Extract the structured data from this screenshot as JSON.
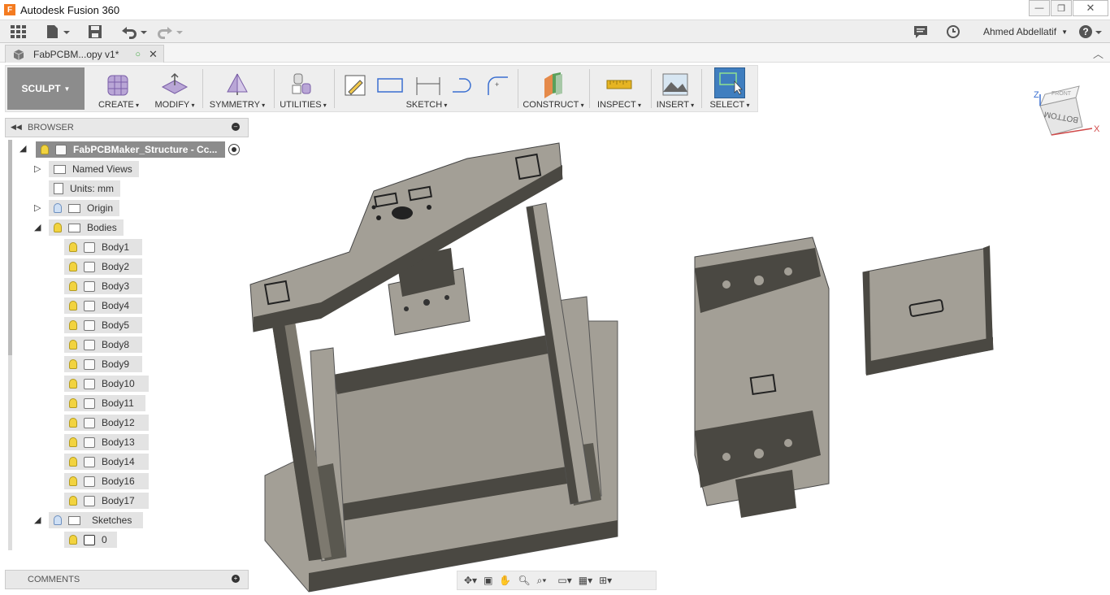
{
  "app": {
    "title": "Autodesk Fusion 360",
    "logo_letter": "F"
  },
  "user": {
    "name": "Ahmed Abdellatif"
  },
  "document": {
    "tab_label": "FabPCBM...opy v1*"
  },
  "ribbon": {
    "workspace": "SCULPT",
    "groups": [
      {
        "label": "CREATE"
      },
      {
        "label": "MODIFY"
      },
      {
        "label": "SYMMETRY"
      },
      {
        "label": "UTILITIES"
      },
      {
        "label": "SKETCH"
      },
      {
        "label": "CONSTRUCT"
      },
      {
        "label": "INSPECT"
      },
      {
        "label": "INSERT"
      },
      {
        "label": "SELECT"
      }
    ]
  },
  "browser": {
    "title": "BROWSER",
    "root": "FabPCBMaker_Structure - Cc...",
    "named_views": "Named Views",
    "units": "Units: mm",
    "origin": "Origin",
    "bodies": "Bodies",
    "body_items": [
      "Body1",
      "Body2",
      "Body3",
      "Body4",
      "Body5",
      "Body8",
      "Body9",
      "Body10",
      "Body11",
      "Body12",
      "Body13",
      "Body14",
      "Body16",
      "Body17"
    ],
    "sketches": "Sketches",
    "sketch_items": [
      "0"
    ]
  },
  "comments": {
    "title": "COMMENTS"
  },
  "viewcube": {
    "top_label": "FRONT",
    "face_label": "BOTTOM",
    "axis_z": "Z",
    "axis_x": "X"
  },
  "colors": {
    "ribbon_bg": "#eeeeee",
    "sculpt_bg": "#8c8c8c",
    "select_accent": "#3f7ebf",
    "model_face": "#a39f96",
    "model_dark": "#4a4842",
    "browser_node": "#e3e3e3"
  }
}
